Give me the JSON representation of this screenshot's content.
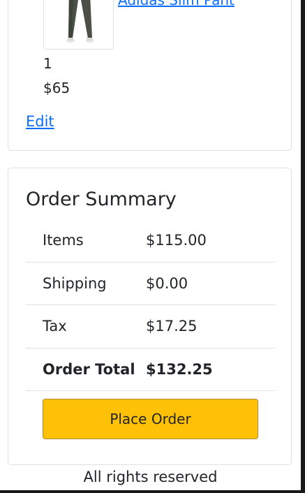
{
  "order_items": {
    "item": {
      "name": "Adidas Slim Pant",
      "image_icon": "pants-image-icon",
      "quantity": "1",
      "price": "$65"
    },
    "edit_label": "Edit"
  },
  "order_summary": {
    "title": "Order Summary",
    "rows": [
      {
        "label": "Items",
        "value": "$115.00"
      },
      {
        "label": "Shipping",
        "value": "$0.00"
      },
      {
        "label": "Tax",
        "value": "$17.25"
      },
      {
        "label": "Order Total",
        "value": "$132.25"
      }
    ],
    "place_order_label": "Place Order"
  },
  "footer": {
    "text": "All rights reserved"
  },
  "colors": {
    "link": "#0d6efd",
    "button": "#ffc107",
    "border": "#dee2e6"
  }
}
